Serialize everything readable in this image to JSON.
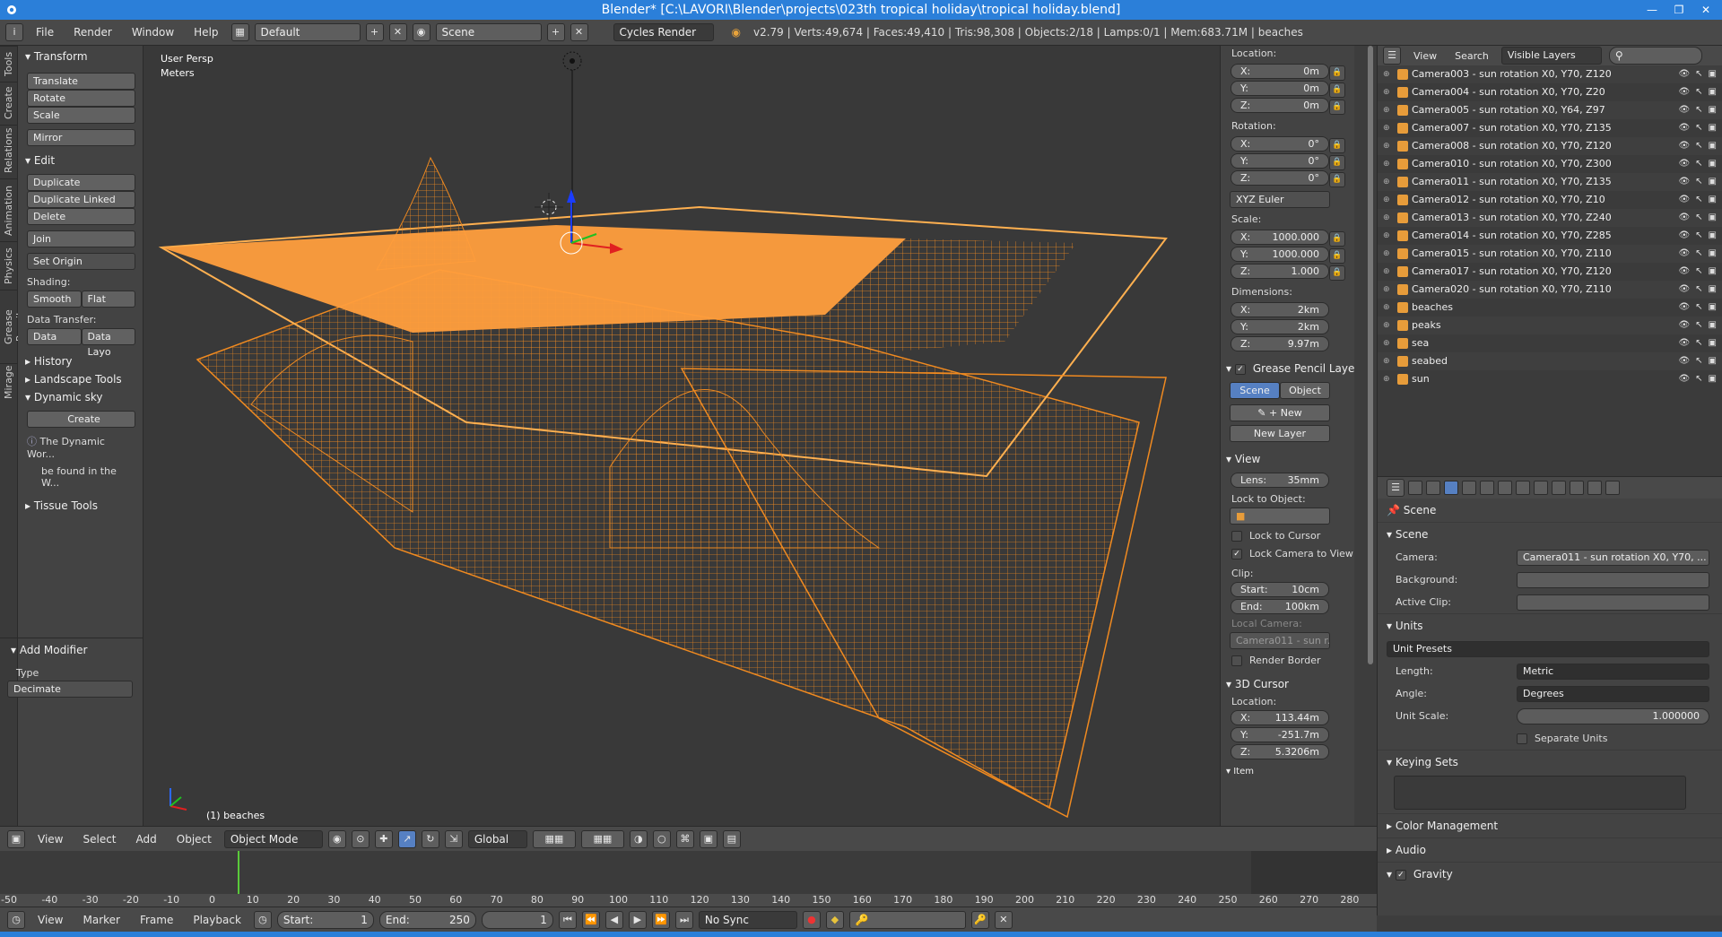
{
  "window": {
    "title": "Blender* [C:\\LAVORI\\Blender\\projects\\023th tropical holiday\\tropical holiday.blend]"
  },
  "menubar": {
    "items": [
      "File",
      "Render",
      "Window",
      "Help"
    ],
    "layout": "Default",
    "scene": "Scene",
    "engine": "Cycles Render",
    "stats": "v2.79 | Verts:49,674 | Faces:49,410 | Tris:98,308 | Objects:2/18 | Lamps:0/1 | Mem:683.71M | beaches"
  },
  "tabs": [
    "Tools",
    "Create",
    "Relations",
    "Animation",
    "Physics",
    "Grease Pencil",
    "Mirage"
  ],
  "toolshelf": {
    "transform": "Transform",
    "translate": "Translate",
    "rotate": "Rotate",
    "scale": "Scale",
    "mirror": "Mirror",
    "edit": "Edit",
    "duplicate": "Duplicate",
    "duplicate_linked": "Duplicate Linked",
    "delete": "Delete",
    "join": "Join",
    "set_origin": "Set Origin",
    "shading": "Shading:",
    "smooth": "Smooth",
    "flat": "Flat",
    "data_transfer": "Data Transfer:",
    "data": "Data",
    "data_layout": "Data Layo",
    "history": "History",
    "landscape": "Landscape Tools",
    "dynamic_sky": "Dynamic sky",
    "create": "Create",
    "info1": "The Dynamic Wor...",
    "info2": "be found in the W...",
    "tissue": "Tissue Tools",
    "add_modifier": "Add Modifier",
    "type": "Type",
    "decimate": "Decimate"
  },
  "viewport": {
    "persp": "User Persp",
    "units": "Meters",
    "object": "(1) beaches"
  },
  "npanel": {
    "location": "Location:",
    "loc": [
      {
        "k": "X:",
        "v": "0m"
      },
      {
        "k": "Y:",
        "v": "0m"
      },
      {
        "k": "Z:",
        "v": "0m"
      }
    ],
    "rotation": "Rotation:",
    "rot": [
      {
        "k": "X:",
        "v": "0°"
      },
      {
        "k": "Y:",
        "v": "0°"
      },
      {
        "k": "Z:",
        "v": "0°"
      }
    ],
    "euler": "XYZ Euler",
    "scale": "Scale:",
    "scl": [
      {
        "k": "X:",
        "v": "1000.000"
      },
      {
        "k": "Y:",
        "v": "1000.000"
      },
      {
        "k": "Z:",
        "v": "1.000"
      }
    ],
    "dimensions": "Dimensions:",
    "dim": [
      {
        "k": "X:",
        "v": "2km"
      },
      {
        "k": "Y:",
        "v": "2km"
      },
      {
        "k": "Z:",
        "v": "9.97m"
      }
    ],
    "gp_layers": "Grease Pencil Layers",
    "scene_btn": "Scene",
    "object_btn": "Object",
    "new": "New",
    "new_layer": "New Layer",
    "view": "View",
    "lens_k": "Lens:",
    "lens_v": "35mm",
    "lock_object": "Lock to Object:",
    "lock_cursor": "Lock to Cursor",
    "lock_camera": "Lock Camera to View",
    "clip": "Clip:",
    "clip_start_k": "Start:",
    "clip_start_v": "10cm",
    "clip_end_k": "End:",
    "clip_end_v": "100km",
    "local_camera": "Local Camera:",
    "local_camera_v": "Camera011 - sun r...",
    "render_border": "Render Border",
    "cursor": "3D Cursor",
    "cursor_loc": "Location:",
    "cur": [
      {
        "k": "X:",
        "v": "113.44m"
      },
      {
        "k": "Y:",
        "v": "-251.7m"
      },
      {
        "k": "Z:",
        "v": "5.3206m"
      }
    ],
    "item": "Item"
  },
  "outliner": {
    "view": "View",
    "search": "Search",
    "filter": "Visible Layers",
    "rows": [
      "Camera003 - sun rotation X0, Y70, Z120",
      "Camera004 - sun rotation X0, Y70, Z20",
      "Camera005 - sun rotation X0, Y64, Z97",
      "Camera007 - sun rotation X0, Y70, Z135",
      "Camera008 - sun rotation X0, Y70, Z120",
      "Camera010 - sun rotation X0, Y70, Z300",
      "Camera011 - sun rotation X0, Y70, Z135",
      "Camera012 - sun rotation X0, Y70, Z10",
      "Camera013 - sun rotation X0, Y70, Z240",
      "Camera014 - sun rotation X0, Y70, Z285",
      "Camera015 - sun rotation X0, Y70, Z110",
      "Camera017 - sun rotation X0, Y70, Z120",
      "Camera020 - sun rotation X0, Y70, Z110",
      "beaches",
      "peaks",
      "sea",
      "seabed",
      "sun"
    ]
  },
  "props": {
    "scene_crumb": "Scene",
    "scene": "Scene",
    "camera_k": "Camera:",
    "camera_v": "Camera011 - sun rotation X0, Y70, ...",
    "background_k": "Background:",
    "clip_k": "Active Clip:",
    "units": "Units",
    "unit_presets": "Unit Presets",
    "length_k": "Length:",
    "length_v": "Metric",
    "angle_k": "Angle:",
    "angle_v": "Degrees",
    "unit_scale_k": "Unit Scale:",
    "unit_scale_v": "1.000000",
    "separate_units": "Separate Units",
    "keying_sets": "Keying Sets",
    "color_mgmt": "Color Management",
    "audio": "Audio",
    "gravity": "Gravity"
  },
  "vpheader": {
    "view": "View",
    "select": "Select",
    "add": "Add",
    "object": "Object",
    "mode": "Object Mode",
    "orientation": "Global"
  },
  "timeline": {
    "ticks": [
      "-50",
      "-40",
      "-30",
      "-20",
      "-10",
      "0",
      "10",
      "20",
      "30",
      "40",
      "50",
      "60",
      "70",
      "80",
      "90",
      "100",
      "110",
      "120",
      "130",
      "140",
      "150",
      "160",
      "170",
      "180",
      "190",
      "200",
      "210",
      "220",
      "230",
      "240",
      "250",
      "260",
      "270",
      "280"
    ]
  },
  "tlheader": {
    "view": "View",
    "marker": "Marker",
    "frame": "Frame",
    "playback": "Playback",
    "start": "Start:",
    "start_v": "1",
    "end": "End:",
    "end_v": "250",
    "current": "1",
    "sync": "No Sync"
  },
  "colors": {
    "wire": "#ff8a1e",
    "accent": "#5680c2"
  }
}
